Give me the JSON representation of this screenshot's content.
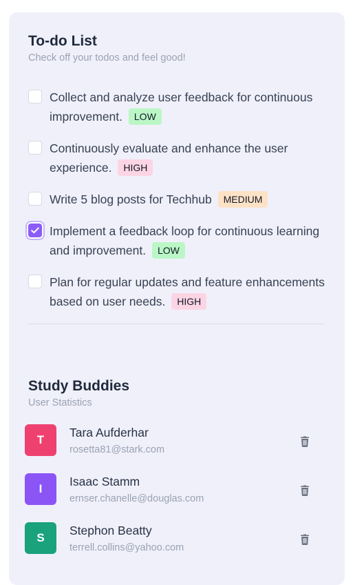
{
  "todo": {
    "title": "To-do List",
    "subtitle": "Check off your todos and feel good!",
    "items": [
      {
        "text": "Collect and analyze user feedback for continuous improvement.",
        "priority": "LOW",
        "checked": false
      },
      {
        "text": "Continuously evaluate and enhance the user experience.",
        "priority": "HIGH",
        "checked": false
      },
      {
        "text": "Write 5 blog posts for Techhub",
        "priority": "MEDIUM",
        "checked": false
      },
      {
        "text": "Implement a feedback loop for continuous learning and improvement.",
        "priority": "LOW",
        "checked": true
      },
      {
        "text": "Plan for regular updates and feature enhancements based on user needs.",
        "priority": "HIGH",
        "checked": false
      }
    ]
  },
  "priority_colors": {
    "LOW": "#bbf7c6",
    "HIGH": "#fcd5e4",
    "MEDIUM": "#fde2c5"
  },
  "accent_color": "#8b5cf6",
  "buddies": {
    "title": "Study Buddies",
    "subtitle": "User Statistics",
    "users": [
      {
        "initial": "T",
        "name": "Tara Aufderhar",
        "email": "rosetta81@stark.com",
        "color": "#ef4170",
        "icon": "trash-icon"
      },
      {
        "initial": "I",
        "name": "Isaac Stamm",
        "email": "ernser.chanelle@douglas.com",
        "color": "#8b55f6",
        "icon": "trash-icon"
      },
      {
        "initial": "S",
        "name": "Stephon Beatty",
        "email": "terrell.collins@yahoo.com",
        "color": "#1aa27c",
        "icon": "trash-icon"
      }
    ]
  }
}
